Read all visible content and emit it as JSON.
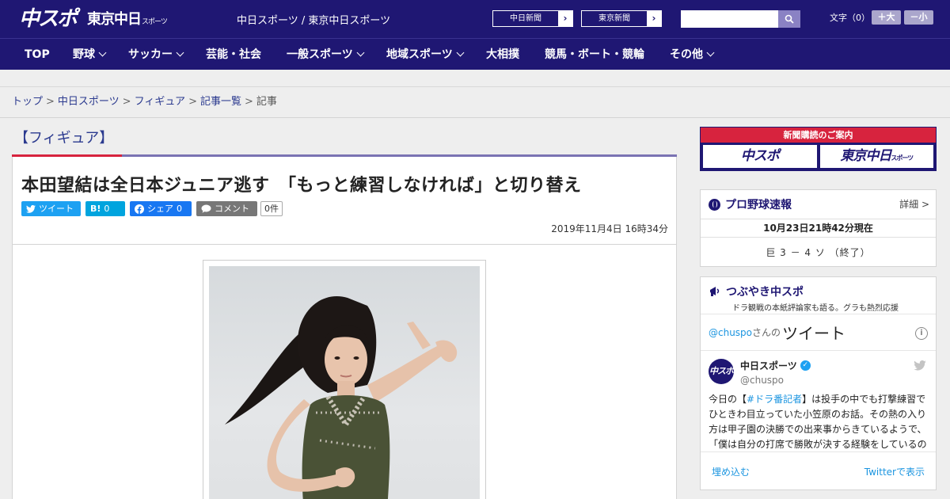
{
  "header": {
    "logo_main": "中スポ",
    "logo_tokyo": "東京中日",
    "logo_tokyo_suffix": "スポーツ",
    "site_name": "中日スポーツ / 東京中日スポーツ",
    "paper_links": [
      "中日新聞",
      "東京新聞"
    ],
    "search": {
      "placeholder": ""
    },
    "font_size": {
      "label": "文字（0）",
      "increase": "＋大",
      "decrease": "－小"
    }
  },
  "nav": {
    "items": [
      {
        "label": "TOP",
        "dropdown": false
      },
      {
        "label": "野球",
        "dropdown": true
      },
      {
        "label": "サッカー",
        "dropdown": true
      },
      {
        "label": "芸能・社会",
        "dropdown": false
      },
      {
        "label": "一般スポーツ",
        "dropdown": true
      },
      {
        "label": "地域スポーツ",
        "dropdown": true
      },
      {
        "label": "大相撲",
        "dropdown": false
      },
      {
        "label": "競馬・ボート・競輪",
        "dropdown": false
      },
      {
        "label": "その他",
        "dropdown": true
      }
    ]
  },
  "breadcrumb": {
    "items": [
      "トップ",
      "中日スポーツ",
      "フィギュア",
      "記事一覧"
    ],
    "current": "記事",
    "separator": ">"
  },
  "article": {
    "category": "【フィギュア】",
    "headline": "本田望結は全日本ジュニア逃す　「もっと練習しなければ」と切り替え",
    "share": {
      "tweet": "ツイート",
      "hatena_label": "B!",
      "hatena_count": "0",
      "facebook": "シェア",
      "facebook_count": "0",
      "comment": "コメント",
      "comment_count": "0件"
    },
    "date": "2019年11月4日 16時34分"
  },
  "sidebar": {
    "subscription": {
      "title": "新聞購読のご案内",
      "left": "中スポ",
      "right": "東京中日",
      "right_suffix": "スポーツ"
    },
    "baseball": {
      "title": "プロ野球速報",
      "detail": "詳細 >",
      "as_of": "10月23日21時42分現在",
      "score": "巨 3 － 4 ソ （終了）"
    },
    "tsubuyaki": {
      "title": "つぶやき中スポ",
      "subtitle": "ドラ観戦の本紙評論家も語る。グラも熱烈応援",
      "handle_link": "@chuspo",
      "handle_suffix": "さんの",
      "tweets_label": "ツイート",
      "user_display": "中日スポーツ",
      "user_handle": "@chuspo",
      "avatar_text": "中スポ",
      "tweet_pre": "今日の【",
      "tweet_hash": "#ドラ番記者",
      "tweet_body": "】は投手の中でも打撃練習でひときわ目立っていた小笠原のお話。その熱の入り方は甲子園の決勝での出来事からきているようで、「僕は自分の打席で勝敗が決する経験をしているの",
      "embed": "埋め込む",
      "view_on_twitter": "Twitterで表示"
    }
  },
  "colors": {
    "brand_navy": "#1f1773",
    "accent_red": "#d7233e",
    "link_blue": "#2b3a8f",
    "twitter_blue": "#1da1f2"
  }
}
